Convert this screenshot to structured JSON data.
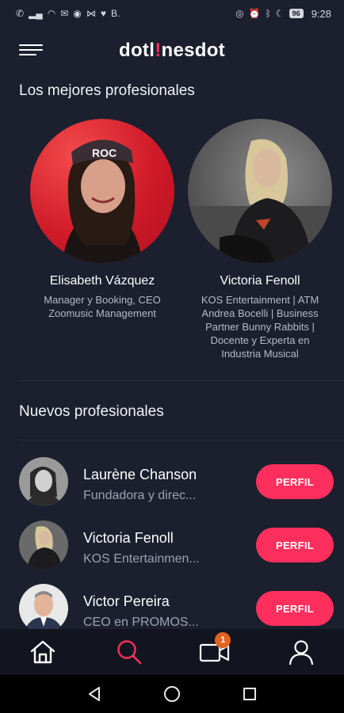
{
  "app": {
    "logo_main": "dotl",
    "logo_accent": "!",
    "logo_rest": "nesdot",
    "brand_color": "#ff2f5d"
  },
  "status_bar": {
    "time": "9:28",
    "battery": "96",
    "left_icons": [
      "call-icon",
      "signal-icon",
      "wifi-icon",
      "mail-icon",
      "spotify-icon",
      "gmail-icon",
      "twitter-icon",
      "behance-icon"
    ],
    "right_icons": [
      "eye-icon",
      "alarm-icon",
      "bluetooth-icon",
      "moon-icon"
    ]
  },
  "sections": {
    "best_title": "Los mejores profesionales",
    "new_title": "Nuevos profesionales"
  },
  "featured": [
    {
      "name": "Elisabeth Vázquez",
      "role": "Manager y Booking, CEO Zoomusic Management"
    },
    {
      "name": "Victoria Fenoll",
      "role": "KOS Entertainment | ATM Andrea Bocelli | Business Partner Bunny Rabbits | Docente y Experta en Industria Musical"
    }
  ],
  "new_pros": [
    {
      "name": "Laurène Chanson",
      "subtitle": "Fundadora y direc...",
      "button": "PERFIL"
    },
    {
      "name": "Victoria Fenoll",
      "subtitle": "KOS Entertainmen...",
      "button": "PERFIL"
    },
    {
      "name": "Victor Pereira",
      "subtitle": "CEO en PROMOS...",
      "button": "PERFIL"
    }
  ],
  "tab_bar": {
    "tabs": [
      "home-icon",
      "search-icon",
      "video-icon",
      "profile-icon"
    ],
    "active": "search-icon",
    "video_badge": "1",
    "active_color": "#ff2f5d",
    "badge_color": "#e2631f"
  },
  "nav_bar": {
    "buttons": [
      "back-icon",
      "home-circle-icon",
      "recents-icon"
    ]
  }
}
